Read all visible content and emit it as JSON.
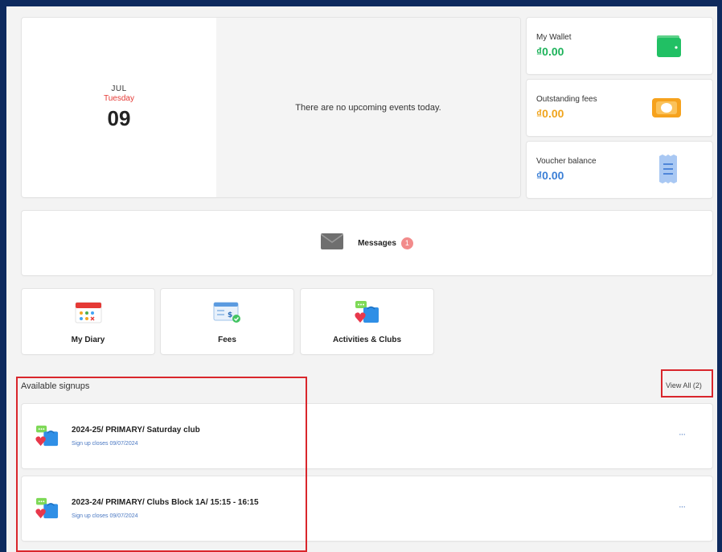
{
  "today": {
    "month": "JUL",
    "weekday": "Tuesday",
    "day": "09",
    "no_events_text": "There are no upcoming events today."
  },
  "balances": [
    {
      "label": "My Wallet",
      "amount": "₫0.00",
      "color": "#1db25a",
      "icon": "wallet-icon"
    },
    {
      "label": "Outstanding fees",
      "amount": "₫0.00",
      "color": "#f0a41c",
      "icon": "banknote-icon"
    },
    {
      "label": "Voucher balance",
      "amount": "₫0.00",
      "color": "#3b7fd6",
      "icon": "receipt-icon"
    }
  ],
  "messages": {
    "label": "Messages",
    "count": "1",
    "icon": "envelope-icon"
  },
  "tiles": [
    {
      "label": "My Diary",
      "icon": "calendar-icon"
    },
    {
      "label": "Fees",
      "icon": "invoice-icon"
    },
    {
      "label": "Activities & Clubs",
      "icon": "clubs-icon"
    }
  ],
  "signups": {
    "title": "Available signups",
    "view_all": "View All (2)",
    "items": [
      {
        "title": "2024-25/ PRIMARY/ Saturday club",
        "closes": "Sign up closes 09/07/2024"
      },
      {
        "title": "2023-24/ PRIMARY/ Clubs Block 1A/ 15:15 - 16:15",
        "closes": "Sign up closes 09/07/2024"
      }
    ],
    "more_label": "···"
  },
  "colors": {
    "accent_red": "#d9262c",
    "weekday_red": "#e53935",
    "link_blue": "#4a78c2",
    "badge": "#f28b8b"
  }
}
